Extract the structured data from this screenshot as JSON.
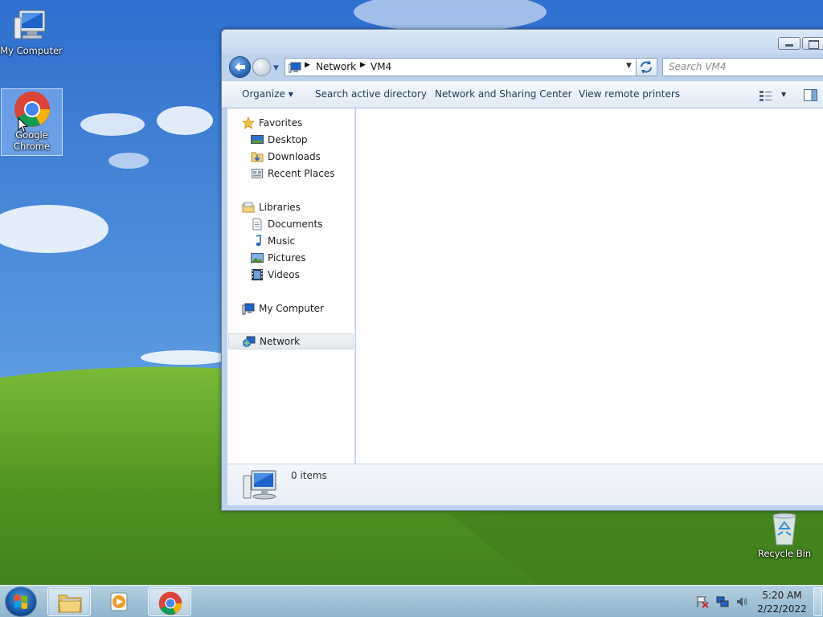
{
  "desktop": {
    "icons": [
      {
        "label": "My Computer"
      },
      {
        "label": "Google Chrome"
      },
      {
        "label": "Recycle Bin"
      }
    ]
  },
  "explorer": {
    "address": {
      "breadcrumbs": [
        "Network",
        "VM4"
      ],
      "search_placeholder": "Search VM4"
    },
    "toolbar": {
      "organize": "Organize",
      "search_ad": "Search active directory",
      "network_sharing": "Network and Sharing Center",
      "remote_printers": "View remote printers"
    },
    "nav": {
      "favorites": "Favorites",
      "desktop": "Desktop",
      "downloads": "Downloads",
      "recent": "Recent Places",
      "libraries": "Libraries",
      "documents": "Documents",
      "music": "Music",
      "pictures": "Pictures",
      "videos": "Videos",
      "my_computer": "My Computer",
      "network": "Network"
    },
    "details": {
      "count": "0 items"
    }
  },
  "taskbar": {
    "apps": [
      "windows-explorer",
      "media-player",
      "google-chrome"
    ],
    "clock": {
      "time": "5:20 AM",
      "date": "2/22/2022"
    }
  },
  "colors": {
    "accent": "#1f5fb0",
    "sky": "#4a8fd8",
    "grass": "#5a9e2c"
  }
}
